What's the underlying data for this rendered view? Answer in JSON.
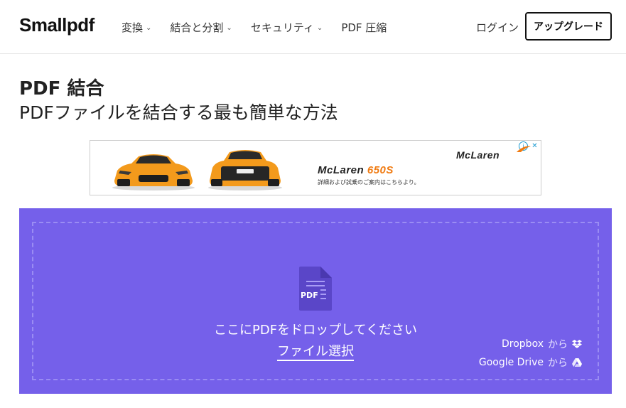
{
  "header": {
    "logo": "Smallpdf",
    "nav": [
      {
        "label": "変換",
        "has_dropdown": true
      },
      {
        "label": "結合と分割",
        "has_dropdown": true
      },
      {
        "label": "セキュリティ",
        "has_dropdown": true
      },
      {
        "label": "PDF 圧縮",
        "has_dropdown": false
      }
    ],
    "login": "ログイン",
    "upgrade": "アップグレード"
  },
  "page": {
    "title": "PDF 結合",
    "subtitle": "PDFファイルを結合する最も簡単な方法"
  },
  "ad": {
    "brand": "McLaren",
    "model": "650S",
    "caption": "詳細および試乗のご案内はこちらより。",
    "corner_brand": "McLaren",
    "info_icon": "info-icon",
    "close_icon": "close-icon"
  },
  "dropzone": {
    "icon_label": "PDF",
    "drop_text": "ここにPDFをドロップしてください",
    "choose_file": "ファイル選択",
    "dropbox_label": "Dropbox",
    "dropbox_from": "から",
    "gdrive_label": "Google Drive",
    "gdrive_from": "から"
  },
  "colors": {
    "accent": "#7560ea",
    "dash": "#9a8cf3",
    "car_orange": "#f39a1c"
  }
}
